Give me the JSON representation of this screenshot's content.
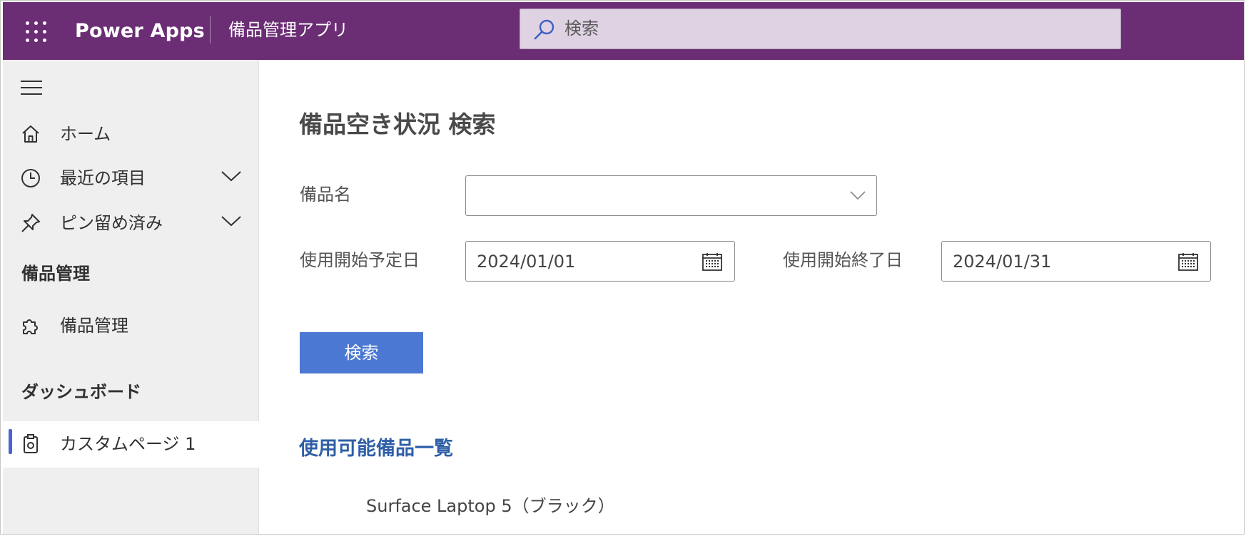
{
  "header": {
    "app_name": "Power Apps",
    "app_title": "備品管理アプリ",
    "search_placeholder": "検索",
    "bg_color": "#6b2d74"
  },
  "sidebar": {
    "nav_items": [
      {
        "label": "ホーム",
        "icon": "home-icon"
      },
      {
        "label": "最近の項目",
        "icon": "clock-icon",
        "expandable": true
      },
      {
        "label": "ピン留め済み",
        "icon": "pin-icon",
        "expandable": true
      }
    ],
    "sections": [
      {
        "heading": "備品管理",
        "items": [
          {
            "label": "備品管理",
            "icon": "puzzle-icon"
          }
        ]
      },
      {
        "heading": "ダッシュボード",
        "items": [
          {
            "label": "カスタムページ 1",
            "icon": "dashboard-page-icon",
            "selected": true
          }
        ]
      }
    ],
    "accent_color": "#4a63d2"
  },
  "main": {
    "title": "備品空き状況 検索",
    "item_name_label": "備品名",
    "item_name_value": "",
    "start_date_label": "使用開始予定日",
    "start_date_value": "2024/01/01",
    "end_date_label": "使用開始終了日",
    "end_date_value": "2024/01/31",
    "search_button": "検索",
    "button_color": "#4a78d2",
    "list_title": "使用可能備品一覧",
    "list_items": [
      "Surface Laptop 5（ブラック）"
    ]
  }
}
